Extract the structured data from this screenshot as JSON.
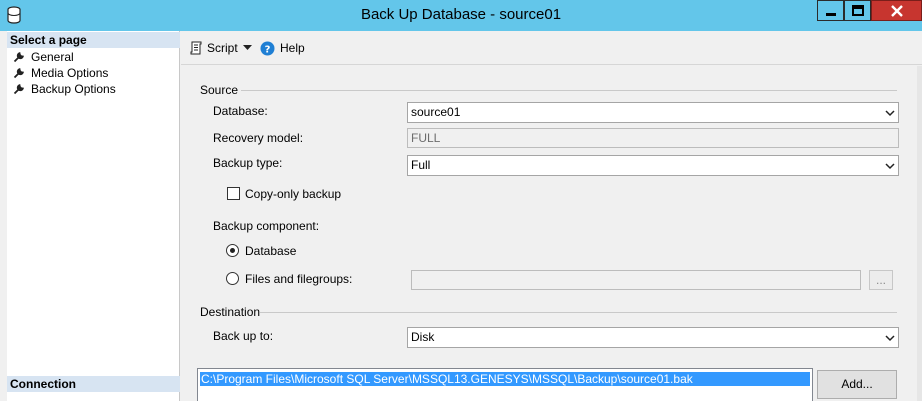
{
  "window": {
    "title": "Back Up Database - source01"
  },
  "left_panel": {
    "select_page_header": "Select a page",
    "pages": [
      {
        "label": "General",
        "icon": "wrench-icon"
      },
      {
        "label": "Media Options",
        "icon": "wrench-icon"
      },
      {
        "label": "Backup Options",
        "icon": "wrench-icon"
      }
    ],
    "connection_header": "Connection"
  },
  "toolbar": {
    "script_label": "Script",
    "help_label": "Help"
  },
  "source": {
    "group_label": "Source",
    "database_label": "Database:",
    "database_value": "source01",
    "recovery_model_label": "Recovery model:",
    "recovery_model_value": "FULL",
    "backup_type_label": "Backup type:",
    "backup_type_value": "Full",
    "copy_only_label": "Copy-only backup",
    "copy_only_checked": false,
    "backup_component_label": "Backup component:",
    "component_database_label": "Database",
    "component_files_label": "Files and filegroups:",
    "component_selected": "Database",
    "files_value": "",
    "browse_label": "..."
  },
  "destination": {
    "group_label": "Destination",
    "back_up_to_label": "Back up to:",
    "back_up_to_value": "Disk",
    "paths": [
      "C:\\Program Files\\Microsoft SQL Server\\MSSQL13.GENESYS\\MSSQL\\Backup\\source01.bak"
    ],
    "add_label": "Add..."
  },
  "colors": {
    "titlebar": "#63c6ea",
    "close_button": "#c7352f",
    "section_header": "#d7e4f2",
    "selection": "#3399ff"
  }
}
